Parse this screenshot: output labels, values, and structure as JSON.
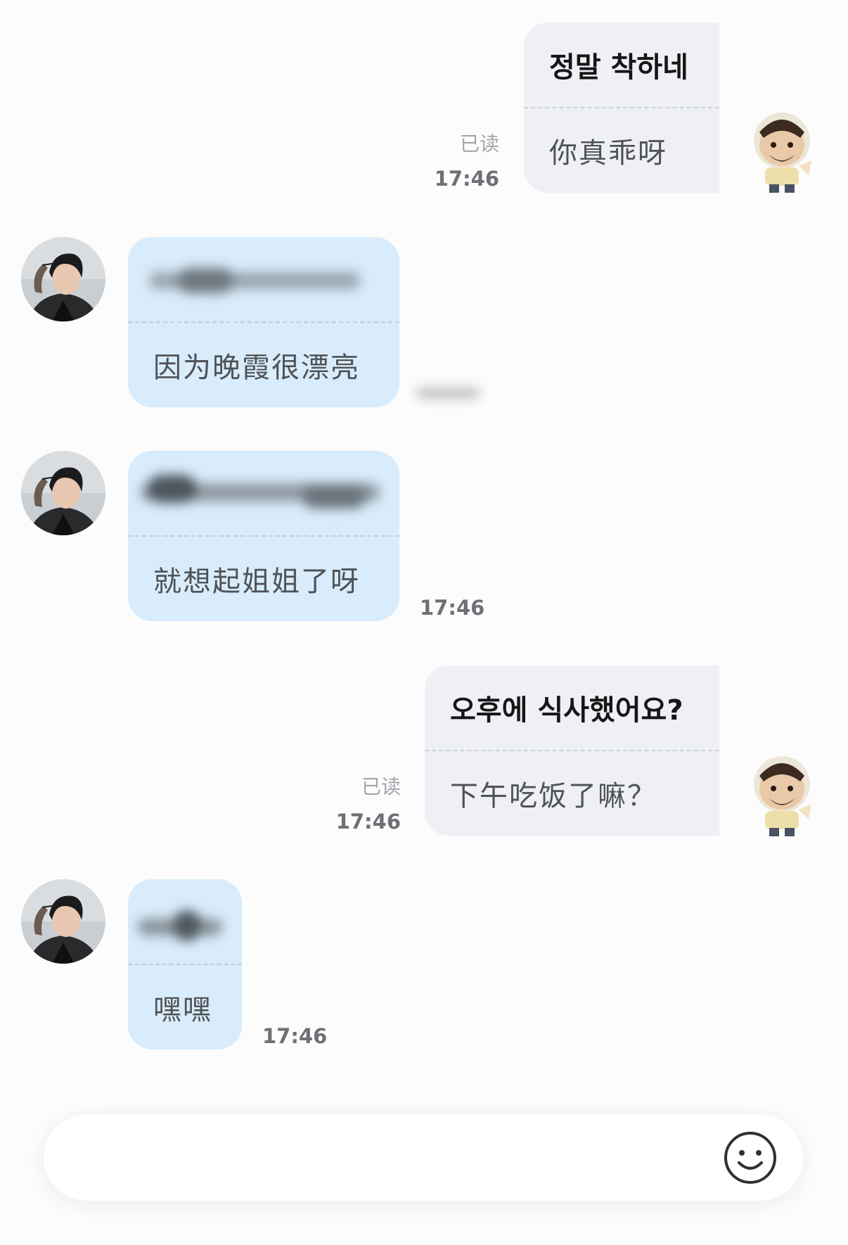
{
  "messages": [
    {
      "direction": "outgoing",
      "original": "정말 착하네",
      "translation": "你真乖呀",
      "read_label": "已读",
      "time": "17:46"
    },
    {
      "direction": "incoming",
      "original": "",
      "translation": "因为晚霞很漂亮",
      "time": ""
    },
    {
      "direction": "incoming",
      "original": "",
      "translation": "就想起姐姐了呀",
      "time": "17:46"
    },
    {
      "direction": "outgoing",
      "original": "오후에 식사했어요?",
      "translation": "下午吃饭了嘛？",
      "read_label": "已读",
      "time": "17:46"
    },
    {
      "direction": "incoming",
      "original": "",
      "translation": "嘿嘿",
      "time": "17:46"
    }
  ],
  "input": {
    "placeholder": "",
    "emoji_icon": "smiley-icon"
  },
  "colors": {
    "outgoing_bubble": "#eef0f5",
    "incoming_bubble": "#d8ecfb",
    "background": "#fcfcfd"
  }
}
